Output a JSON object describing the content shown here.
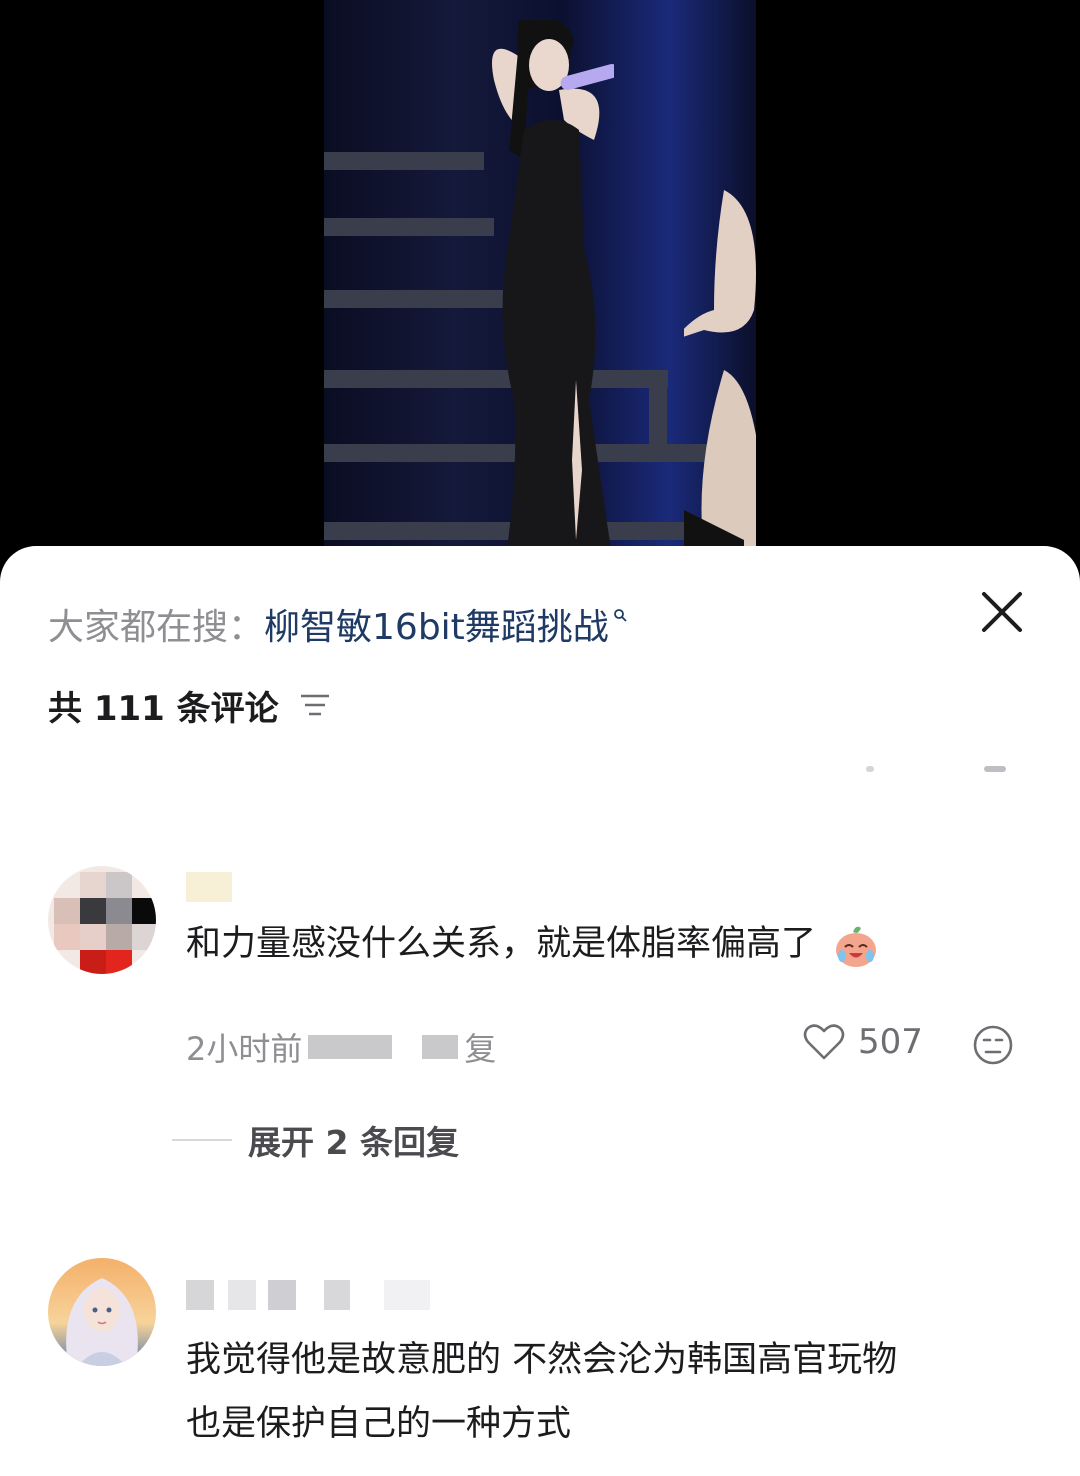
{
  "search_bar": {
    "prefix": "大家都在搜：",
    "term": "柳智敏16bit舞蹈挑战"
  },
  "comments_header": {
    "count_text": "共 111 条评论"
  },
  "comments": [
    {
      "text": "和力量感没什么关系，就是体脂率偏高了",
      "emoji": "crying-laughing-peach-emoji",
      "time": "2小时前",
      "reply_label": "复",
      "likes": "507"
    },
    {
      "text_line1": "我觉得他是故意肥的 不然会沦为韩国高官玩物",
      "text_line2": "也是保护自己的一种方式"
    }
  ],
  "replies": {
    "expand_label": "展开 2 条回复"
  },
  "colors": {
    "search_term": "#1f3a64",
    "muted": "#8e8e93",
    "text": "#1c1c1e"
  }
}
